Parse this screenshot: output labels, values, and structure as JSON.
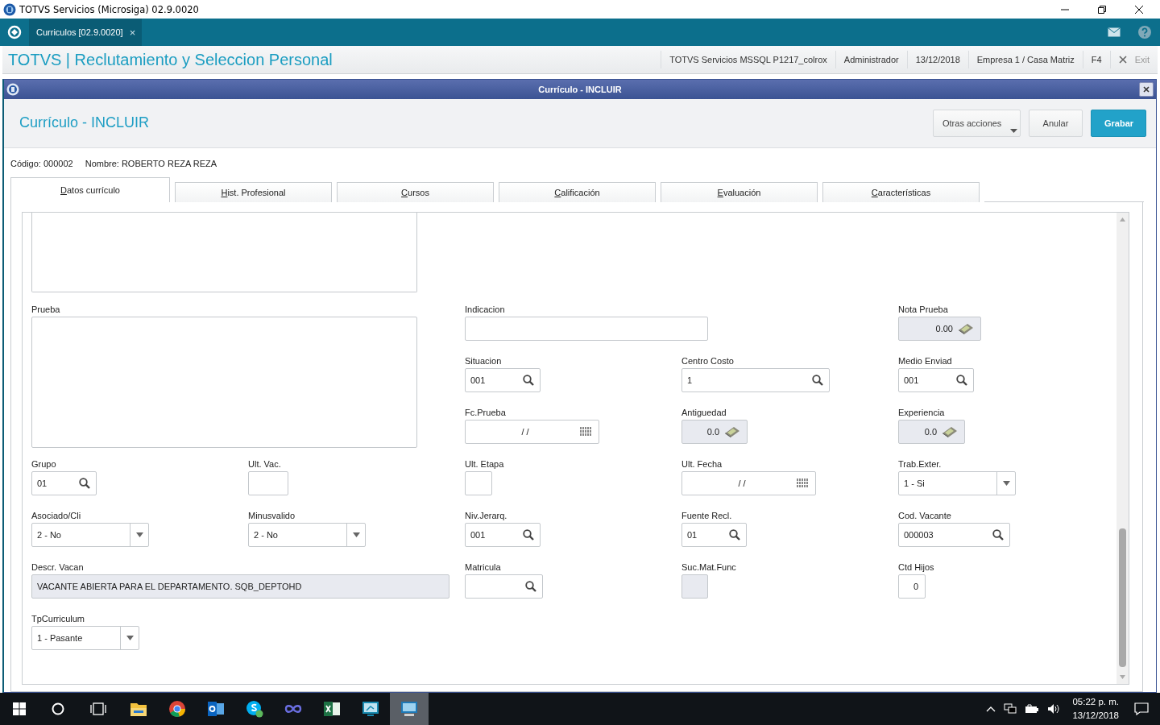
{
  "window": {
    "title": "TOTVS Servicios (Microsiga) 02.9.0020"
  },
  "app_tabs": [
    {
      "label": "Curriculos [02.9.0020]",
      "close": "×",
      "selected": true
    }
  ],
  "module": {
    "title": "TOTVS | Reclutamiento y Seleccion Personal",
    "info": [
      "TOTVS Servicios MSSQL P1217_colrox",
      "Administrador",
      "13/12/2018",
      "Empresa 1 / Casa Matriz",
      "F4"
    ],
    "exit": "Exit"
  },
  "dialog": {
    "title": "Currículo - INCLUIR",
    "heading": "Currículo - INCLUIR",
    "buttons": [
      {
        "label": "Otras acciones",
        "kind": "menu"
      },
      {
        "label": "Anular",
        "kind": "plain"
      },
      {
        "label": "Grabar",
        "kind": "primary"
      }
    ],
    "record": [
      "Código: 000002",
      "Nombre: ROBERTO REZA REZA"
    ],
    "tabs": [
      {
        "label": "Datos currículo",
        "selected": true
      },
      {
        "label": "Hist. Profesional",
        "selected": false
      },
      {
        "label": "Cursos",
        "selected": false
      },
      {
        "label": "Calificación",
        "selected": false
      },
      {
        "label": "Evaluación",
        "selected": false
      },
      {
        "label": "Características",
        "selected": false
      }
    ],
    "fields": [
      {
        "kind": "memo",
        "readonly": false
      },
      {
        "label": "Prueba",
        "kind": "memo",
        "readonly": false
      },
      {
        "label": "Indicacion",
        "kind": "text",
        "readonly": false
      },
      {
        "label": "Nota Prueba",
        "kind": "numeric",
        "value": "0.00",
        "readonly": true
      },
      {
        "label": "Situacion",
        "kind": "lookup",
        "value": "001",
        "readonly": false
      },
      {
        "label": "Centro Costo",
        "kind": "lookup",
        "value": "1",
        "readonly": false
      },
      {
        "label": "Medio Enviad",
        "kind": "lookup",
        "value": "001",
        "readonly": false
      },
      {
        "label": "Fc.Prueba",
        "kind": "date",
        "value": "/ /",
        "readonly": false
      },
      {
        "label": "Antiguedad",
        "kind": "numeric",
        "value": "0.0",
        "readonly": true
      },
      {
        "label": "Experiencia",
        "kind": "numeric",
        "value": "0.0",
        "readonly": true
      },
      {
        "label": "Grupo",
        "kind": "lookup",
        "value": "01",
        "readonly": false
      },
      {
        "label": "Ult. Vac.",
        "kind": "text",
        "readonly": false
      },
      {
        "label": "Ult. Etapa",
        "kind": "text",
        "readonly": false
      },
      {
        "label": "Ult. Fecha",
        "kind": "date",
        "value": "/ /",
        "readonly": false
      },
      {
        "label": "Trab.Exter.",
        "kind": "select",
        "value": "1 - Si",
        "readonly": false
      },
      {
        "label": "Asociado/Cli",
        "kind": "select",
        "value": "2 - No",
        "readonly": false
      },
      {
        "label": "Minusvalido",
        "kind": "select",
        "value": "2 - No",
        "readonly": false
      },
      {
        "label": "Niv.Jerarq.",
        "kind": "lookup",
        "value": "001",
        "readonly": false
      },
      {
        "label": "Fuente Recl.",
        "kind": "lookup",
        "value": "01",
        "readonly": false
      },
      {
        "label": "Cod. Vacante",
        "kind": "lookup",
        "value": "000003",
        "readonly": false
      },
      {
        "label": "Descr. Vacan",
        "kind": "text",
        "value": "VACANTE ABIERTA PARA EL DEPARTAMENTO. SQB_DEPTOHD",
        "readonly": true
      },
      {
        "label": "Matricula",
        "kind": "lookup",
        "readonly": false
      },
      {
        "label": "Suc.Mat.Func",
        "kind": "text",
        "readonly": true
      },
      {
        "label": "Ctd Hijos",
        "kind": "integer",
        "value": "0",
        "readonly": false
      },
      {
        "label": "TpCurriculum",
        "kind": "select",
        "value": "1 - Pasante",
        "readonly": false
      }
    ]
  },
  "taskbar": {
    "apps": [
      {
        "kind": "explorer",
        "selected": false
      },
      {
        "kind": "chrome",
        "selected": false
      },
      {
        "kind": "outlook",
        "selected": false
      },
      {
        "kind": "skype",
        "selected": false
      },
      {
        "kind": "infinity",
        "selected": false
      },
      {
        "kind": "excel",
        "selected": false
      },
      {
        "kind": "remote",
        "selected": false
      },
      {
        "kind": "screen",
        "selected": true
      }
    ],
    "time": "05:22 p. m.",
    "date": "13/12/2018"
  }
}
